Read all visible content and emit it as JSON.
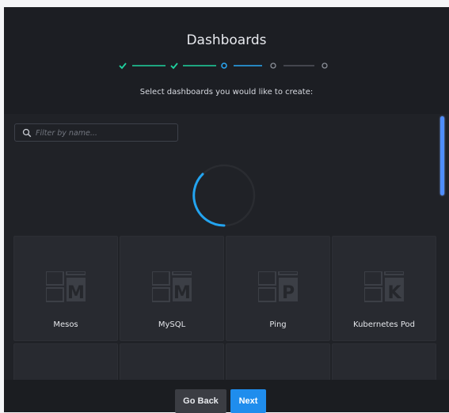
{
  "header": {
    "title": "Dashboards",
    "subtitle": "Select dashboards you would like to create:",
    "steps": [
      {
        "state": "done"
      },
      {
        "state": "done"
      },
      {
        "state": "current"
      },
      {
        "state": "pending"
      },
      {
        "state": "pending"
      }
    ]
  },
  "search": {
    "placeholder": "Filter by name...",
    "value": "",
    "icon": "search-icon"
  },
  "loading": {
    "icon": "loading-spinner"
  },
  "cards": [
    {
      "label": "Mesos",
      "letter": "M"
    },
    {
      "label": "MySQL",
      "letter": "M"
    },
    {
      "label": "Ping",
      "letter": "P"
    },
    {
      "label": "Kubernetes Pod",
      "letter": "K"
    }
  ],
  "footer": {
    "back_label": "Go Back",
    "next_label": "Next"
  },
  "colors": {
    "background": "#202227",
    "accent_green": "#1fd4a0",
    "accent_blue": "#2aa8f5",
    "next_button": "#1f8ded",
    "pending_step": "#8a8e97"
  }
}
